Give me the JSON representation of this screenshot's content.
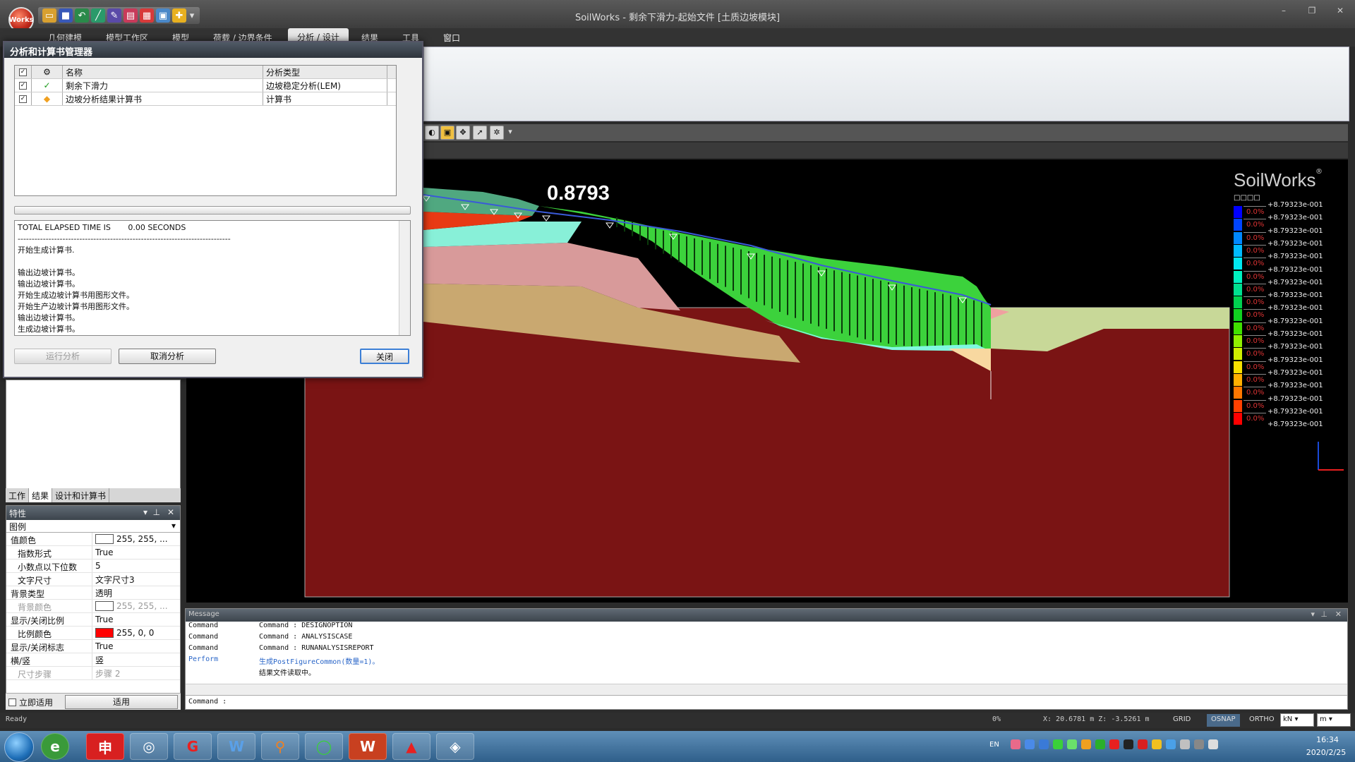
{
  "window": {
    "title": "SoilWorks - 剩余下滑力-起始文件 [土质边坡模块]",
    "logo_text": "Works"
  },
  "menu": {
    "items": [
      "几何建模",
      "模型工作区",
      "模型",
      "荷载 / 边界条件",
      "分析 / 设计",
      "结果",
      "工具",
      "窗口"
    ],
    "active": "分析 / 设计",
    "window_label": "窗口"
  },
  "dialog": {
    "title": "分析和计算书管理器",
    "columns": [
      "名称",
      "分析类型"
    ],
    "rows": [
      {
        "checked": true,
        "status": "ok",
        "name": "剩余下滑力",
        "type": "边坡稳定分析(LEM)"
      },
      {
        "checked": true,
        "status": "report",
        "name": "边坡分析结果计算书",
        "type": "计算书"
      }
    ],
    "log_lines": [
      "TOTAL ELAPSED TIME IS       0.00 SECONDS",
      "----------------------------------------------------------------------------",
      "开始生成计算书.",
      "",
      "输出边坡计算书。",
      "输出边坡计算书。",
      "开始生成边坡计算书用图形文件。",
      "开始生产边坡计算书用图形文件。",
      "输出边坡计算书。",
      "生成边坡计算书。"
    ],
    "buttons": {
      "run": "运行分析",
      "cancel": "取消分析",
      "close": "关闭"
    }
  },
  "viewport": {
    "factor_of_safety": "0.8793",
    "brand": "SoilWorks",
    "brand_sup": "®",
    "legend_subtitle": "□□□□",
    "legend": [
      {
        "color": "#0000ff",
        "pct": "0.0%",
        "value": "+8.79323e-001"
      },
      {
        "color": "#0044ff",
        "pct": "0.0%",
        "value": "+8.79323e-001"
      },
      {
        "color": "#0088ff",
        "pct": "0.0%",
        "value": "+8.79323e-001"
      },
      {
        "color": "#00bbff",
        "pct": "0.0%",
        "value": "+8.79323e-001"
      },
      {
        "color": "#00e8f0",
        "pct": "0.0%",
        "value": "+8.79323e-001"
      },
      {
        "color": "#00f0c0",
        "pct": "0.0%",
        "value": "+8.79323e-001"
      },
      {
        "color": "#00e090",
        "pct": "0.0%",
        "value": "+8.79323e-001"
      },
      {
        "color": "#00d050",
        "pct": "0.0%",
        "value": "+8.79323e-001"
      },
      {
        "color": "#10d020",
        "pct": "0.0%",
        "value": "+8.79323e-001"
      },
      {
        "color": "#40e000",
        "pct": "0.0%",
        "value": "+8.79323e-001"
      },
      {
        "color": "#90f000",
        "pct": "0.0%",
        "value": "+8.79323e-001"
      },
      {
        "color": "#d0f000",
        "pct": "0.0%",
        "value": "+8.79323e-001"
      },
      {
        "color": "#f8e000",
        "pct": "0.0%",
        "value": "+8.79323e-001"
      },
      {
        "color": "#ffb000",
        "pct": "0.0%",
        "value": "+8.79323e-001"
      },
      {
        "color": "#ff7800",
        "pct": "0.0%",
        "value": "+8.79323e-001"
      },
      {
        "color": "#ff4000",
        "pct": "0.0%",
        "value": "+8.79323e-001"
      },
      {
        "color": "#ff0000",
        "pct": "0.0%",
        "value": "+8.79323e-001"
      }
    ],
    "legend_last_value": "+8.79323e-001"
  },
  "left_tabs": [
    "工作",
    "结果",
    "设计和计算书"
  ],
  "properties": {
    "title": "特性",
    "category": "图例",
    "rows": [
      {
        "key": "值颜色",
        "value": "255, 255, ...",
        "swatch": "#ffffff",
        "sub": false,
        "grey": false
      },
      {
        "key": "指数形式",
        "value": "True",
        "sub": true,
        "grey": false
      },
      {
        "key": "小数点以下位数",
        "value": "5",
        "sub": true,
        "grey": false
      },
      {
        "key": "文字尺寸",
        "value": "文字尺寸3",
        "sub": true,
        "grey": false
      },
      {
        "key": "背景类型",
        "value": "透明",
        "sub": false,
        "grey": false
      },
      {
        "key": "背景颜色",
        "value": "255, 255, ...",
        "swatch": "#ffffff",
        "sub": true,
        "grey": true
      },
      {
        "key": "显示/关闭比例",
        "value": "True",
        "sub": false,
        "grey": false
      },
      {
        "key": "比例颜色",
        "value": "255, 0, 0",
        "swatch": "#ff0000",
        "sub": true,
        "grey": false
      },
      {
        "key": "显示/关闭标志",
        "value": "True",
        "sub": false,
        "grey": false
      },
      {
        "key": "横/竖",
        "value": "竖",
        "sub": false,
        "grey": false
      },
      {
        "key": "尺寸步骤",
        "value": "步骤 2",
        "sub": true,
        "grey": true
      }
    ],
    "immediate_label": "立即适用",
    "apply_label": "适用"
  },
  "messages": {
    "title": "Message",
    "lines": [
      {
        "tag": "Command",
        "text": "Command : DESIGNOPTION",
        "perform": false
      },
      {
        "tag": "Command",
        "text": "Command : ANALYSISCASE",
        "perform": false
      },
      {
        "tag": "Command",
        "text": "Command : RUNANALYSISREPORT",
        "perform": false
      },
      {
        "tag": "Perform",
        "text": "生成PostFigureCommon(数量=1)。",
        "perform": true
      },
      {
        "tag": "",
        "text": "结果文件读取中。",
        "perform": false
      }
    ],
    "command_prompt": "Command :"
  },
  "status": {
    "ready": "Ready",
    "percent": "0%",
    "coords": "X: 20.6781 m  Z: -3.5261 m",
    "grid": "GRID",
    "osnap": "OSNAP",
    "ortho": "ORTHO",
    "force_unit": "kN",
    "length_unit": "m"
  },
  "taskbar": {
    "lang": "EN",
    "time": "16:34",
    "date": "2020/2/25"
  },
  "colors": {
    "bedrock": "#7a1414",
    "slip_green": "#3cd23c",
    "accent_blue": "#3c7fd6"
  }
}
